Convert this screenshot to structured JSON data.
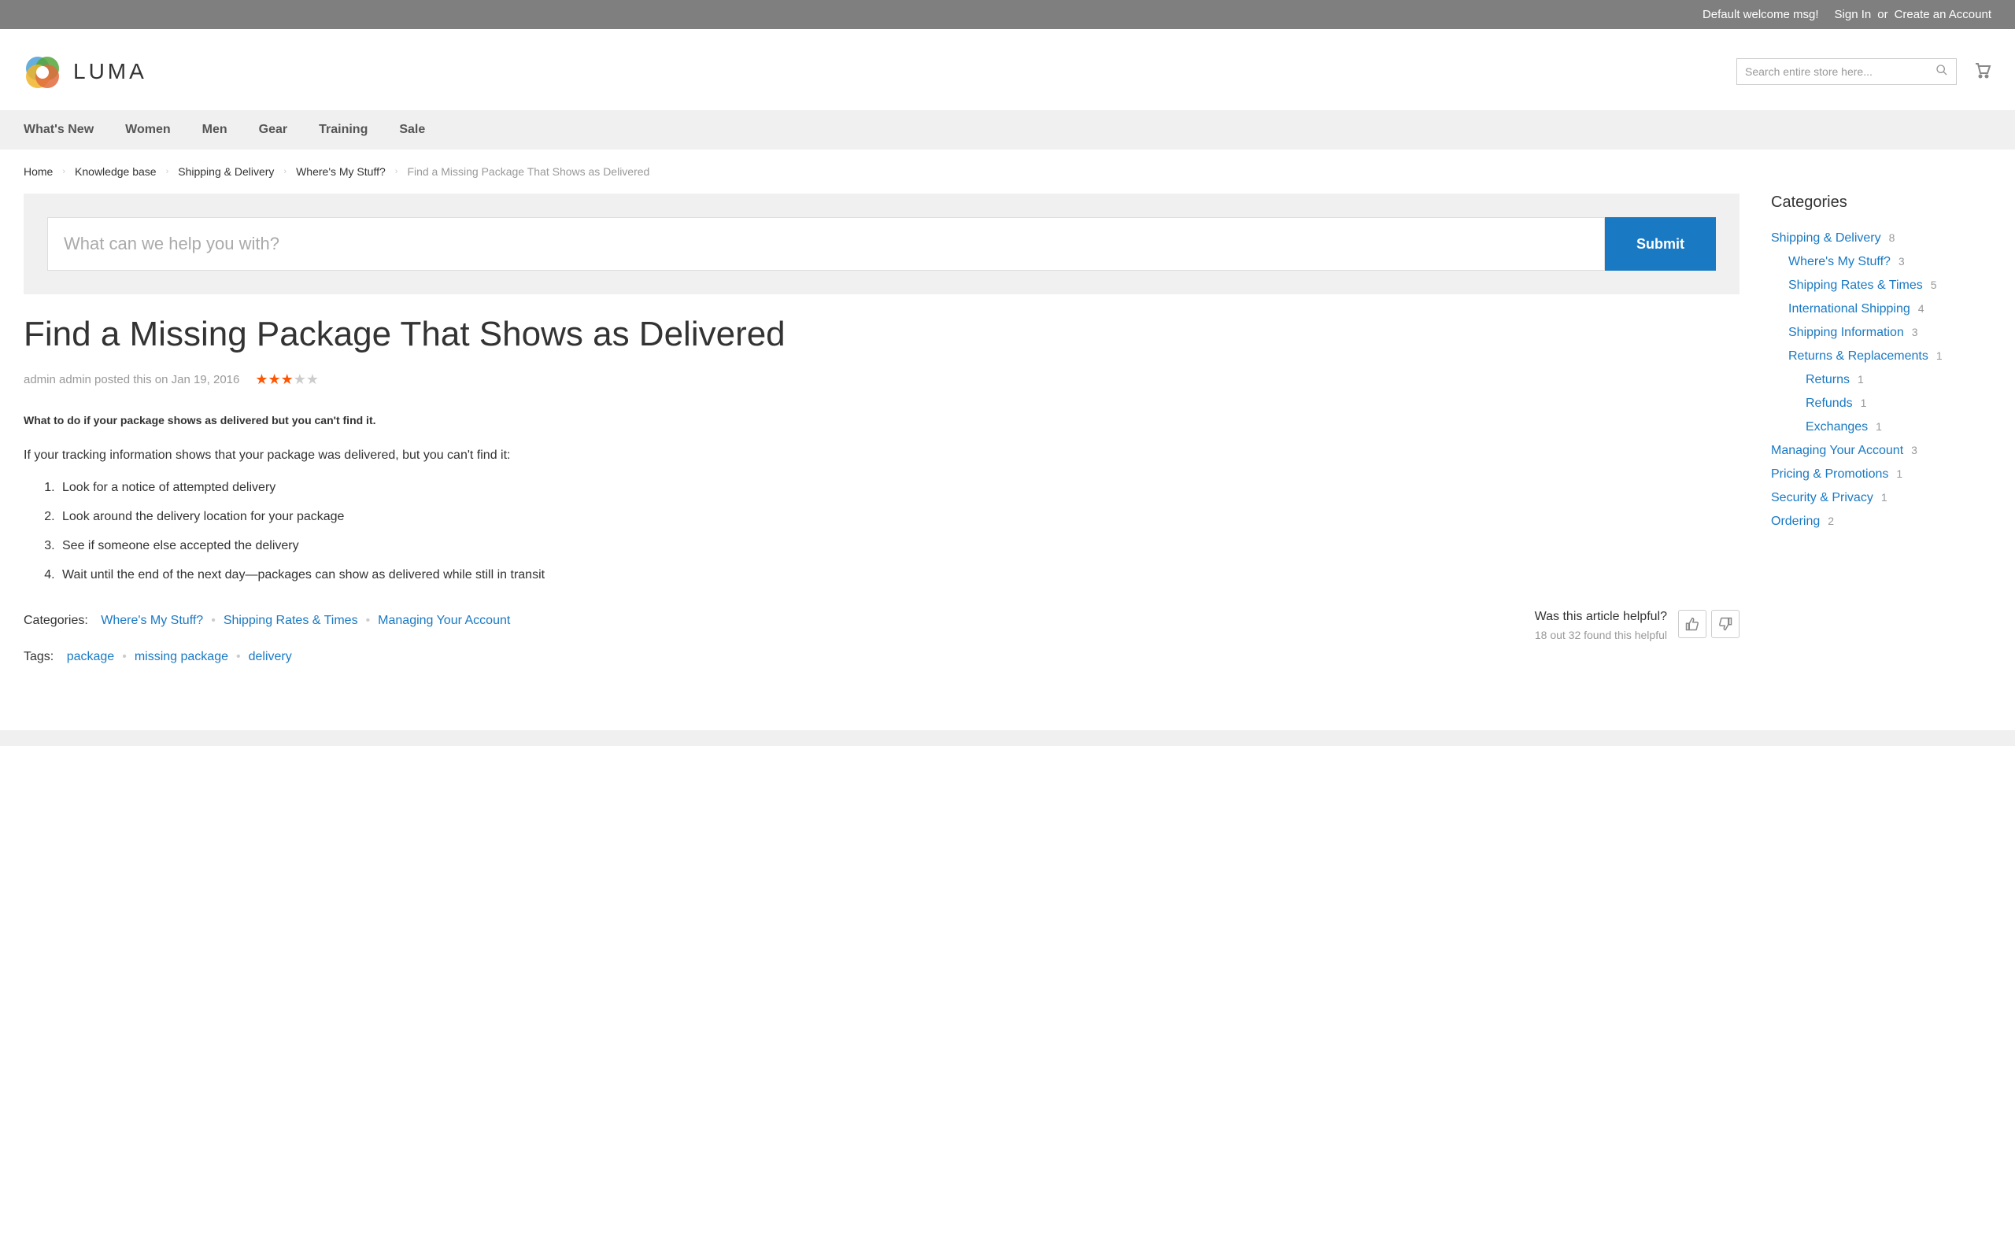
{
  "topbar": {
    "welcome": "Default welcome msg!",
    "signin": "Sign In",
    "or": "or",
    "create": "Create an Account"
  },
  "header": {
    "logo_text": "LUMA",
    "search_placeholder": "Search entire store here..."
  },
  "nav": {
    "items": [
      "What's New",
      "Women",
      "Men",
      "Gear",
      "Training",
      "Sale"
    ]
  },
  "breadcrumb": {
    "items": [
      "Home",
      "Knowledge base",
      "Shipping & Delivery",
      "Where's My Stuff?"
    ],
    "current": "Find a Missing Package That Shows as Delivered"
  },
  "help_search": {
    "placeholder": "What can we help you with?",
    "submit": "Submit"
  },
  "article": {
    "title": "Find a Missing Package That Shows as Delivered",
    "author": "admin admin posted this on Jan 19, 2016",
    "rating_on": 3,
    "rating_total": 5,
    "subtitle": "What to do if your package shows as delivered but you can't find it.",
    "intro": "If your tracking information shows that your package was delivered, but you can't find it:",
    "steps": [
      "Look for a notice of attempted delivery",
      "Look around the delivery location for your package",
      "See if someone else accepted the delivery",
      "Wait until the end of the next day—packages can show as delivered while still in transit"
    ],
    "categories_label": "Categories:",
    "categories": [
      "Where's My Stuff?",
      "Shipping Rates & Times",
      "Managing Your Account"
    ],
    "tags_label": "Tags:",
    "tags": [
      "package",
      "missing package",
      "delivery"
    ],
    "helpful_q": "Was this article helpful?",
    "helpful_stats": "18 out 32 found this helpful"
  },
  "sidebar": {
    "title": "Categories",
    "tree": [
      {
        "label": "Shipping & Delivery",
        "count": 8,
        "children": [
          {
            "label": "Where's My Stuff?",
            "count": 3
          },
          {
            "label": "Shipping Rates & Times",
            "count": 5
          },
          {
            "label": "International Shipping",
            "count": 4
          },
          {
            "label": "Shipping Information",
            "count": 3
          },
          {
            "label": "Returns & Replacements",
            "count": 1,
            "children": [
              {
                "label": "Returns",
                "count": 1
              },
              {
                "label": "Refunds",
                "count": 1
              },
              {
                "label": "Exchanges",
                "count": 1
              }
            ]
          }
        ]
      },
      {
        "label": "Managing Your Account",
        "count": 3
      },
      {
        "label": "Pricing & Promotions",
        "count": 1
      },
      {
        "label": "Security & Privacy",
        "count": 1
      },
      {
        "label": "Ordering",
        "count": 2
      }
    ]
  }
}
